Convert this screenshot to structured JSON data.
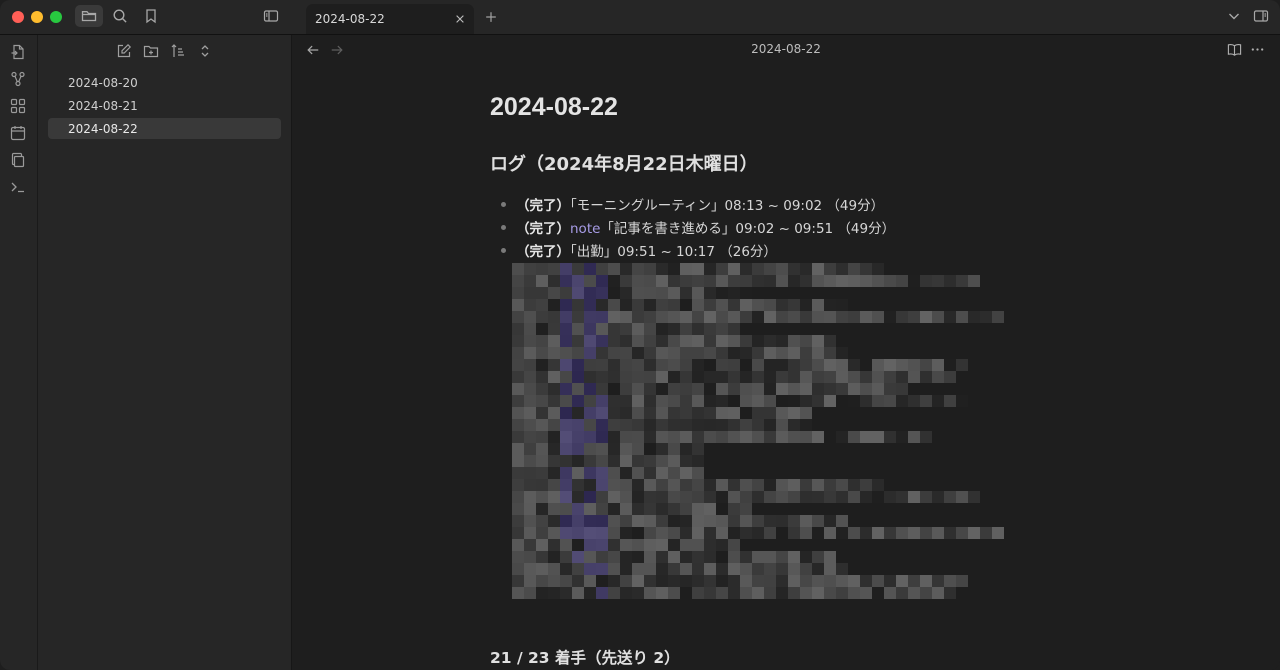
{
  "titlebar": {
    "tab_title": "2024-08-22",
    "icons": [
      "folder-icon",
      "search-icon",
      "bookmark-icon",
      "sidebar-toggle-icon",
      "close-icon",
      "plus-icon",
      "chevron-down-icon",
      "right-sidebar-icon"
    ]
  },
  "ribbon": {
    "icons": [
      "open-quick-switcher-icon",
      "graph-view-icon",
      "canvas-icon",
      "daily-note-icon",
      "templates-icon",
      "command-palette-icon"
    ]
  },
  "sidebar": {
    "tools": [
      "new-note-icon",
      "new-folder-icon",
      "sort-icon",
      "collapse-icon"
    ],
    "files": [
      {
        "label": "2024-08-20"
      },
      {
        "label": "2024-08-21"
      },
      {
        "label": "2024-08-22"
      }
    ],
    "selected_index": 2
  },
  "view": {
    "title": "2024-08-22",
    "note": {
      "h1": "2024-08-22",
      "h2": "ログ（2024年8月22日木曜日）",
      "log": [
        {
          "status": "（完了）",
          "tag": "",
          "text": "「モーニングルーティン」08:13 ~ 09:02 （49分）"
        },
        {
          "status": "（完了）",
          "tag": "note",
          "text": "「記事を書き進める」09:02 ~ 09:51 （49分）"
        },
        {
          "status": "（完了）",
          "tag": "",
          "text": "「出勤」09:51 ~ 10:17 （26分）"
        }
      ],
      "summary": "21 / 23 着手（先送り 2）"
    }
  },
  "colors": {
    "accent": "#a79ce6",
    "background": "#1e1e1e",
    "sidebar": "#262626"
  }
}
